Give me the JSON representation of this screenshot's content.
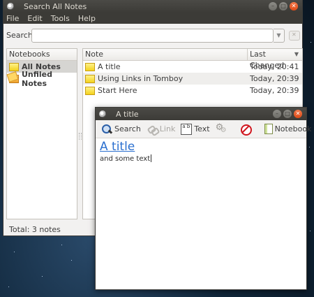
{
  "main_window": {
    "title": "Search All Notes",
    "menu": [
      "File",
      "Edit",
      "Tools",
      "Help"
    ],
    "search": {
      "label": "Search:",
      "value": "",
      "placeholder": ""
    },
    "notebooks": {
      "header": "Notebooks",
      "items": [
        {
          "label": "All Notes",
          "icon": "note-icon",
          "selected": true
        },
        {
          "label": "Unfiled Notes",
          "icon": "notes-stack-icon",
          "selected": false
        }
      ]
    },
    "notes": {
      "columns": {
        "note": "Note",
        "changed": "Last Changed"
      },
      "rows": [
        {
          "title": "A title",
          "changed": "Today, 20:41"
        },
        {
          "title": "Using Links in Tomboy",
          "changed": "Today, 20:39"
        },
        {
          "title": "Start Here",
          "changed": "Today, 20:39"
        }
      ]
    },
    "status": "Total: 3 notes"
  },
  "note_window": {
    "title": "A title",
    "toolbar": {
      "search": "Search",
      "link": "Link",
      "text": "Text",
      "notebook": "Notebook",
      "text_icon_glyph": "a b"
    },
    "content": {
      "title": "A title",
      "body": "and some text"
    }
  }
}
